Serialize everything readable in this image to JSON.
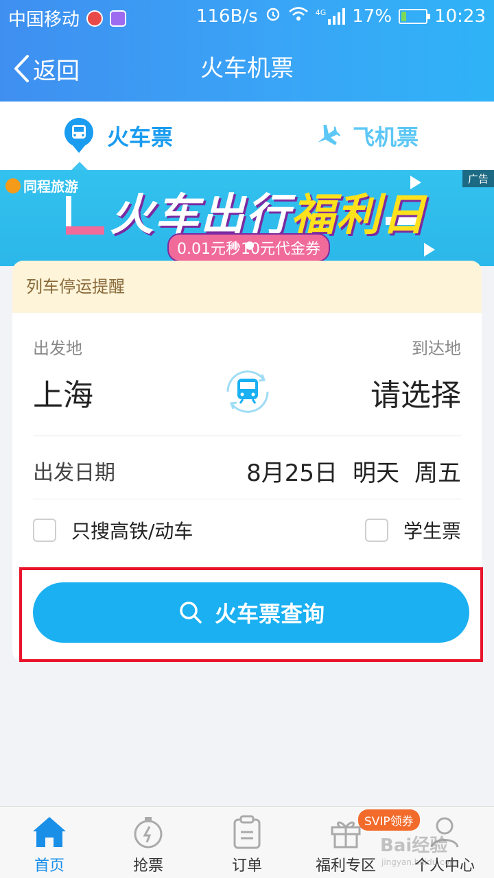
{
  "status_bar": {
    "carrier": "中国移动",
    "network_speed": "116B/s",
    "network_type": "4G",
    "battery": "17%",
    "time": "10:23"
  },
  "nav": {
    "back_label": "返回",
    "title": "火车机票"
  },
  "tabs": {
    "train": "火车票",
    "plane": "飞机票",
    "active": "train"
  },
  "banner": {
    "brand": "同程旅游",
    "ad_label": "广告",
    "title_part1": "火车出行",
    "title_part2": "福利日",
    "subtitle": "0.01元秒10元代金券",
    "slides": 2,
    "active_slide": 2
  },
  "form": {
    "notice": "列车停运提醒",
    "from_label": "出发地",
    "to_label": "到达地",
    "from_city": "上海",
    "to_city": "请选择",
    "date_label": "出发日期",
    "date": "8月25日",
    "relative_day": "明天",
    "weekday": "周五",
    "option_highspeed": "只搜高铁/动车",
    "option_student": "学生票",
    "option_highspeed_checked": false,
    "option_student_checked": false,
    "search_button": "火车票查询"
  },
  "bottom_nav": {
    "items": [
      {
        "label": "首页",
        "icon": "home-icon",
        "active": true
      },
      {
        "label": "抢票",
        "icon": "stopwatch-icon",
        "active": false
      },
      {
        "label": "订单",
        "icon": "clipboard-icon",
        "active": false
      },
      {
        "label": "福利专区",
        "icon": "gift-icon",
        "active": false
      },
      {
        "label": "个人中心",
        "icon": "user-icon",
        "active": false
      }
    ],
    "badge": "SVIP领券"
  },
  "colors": {
    "primary": "#1ab0f2",
    "header": "#3aa4f6",
    "highlight_border": "#e8142b",
    "notice_bg": "#fdf4d9"
  },
  "watermark": {
    "text": "Bai经验",
    "sub": "jingyan.baidu.com"
  }
}
